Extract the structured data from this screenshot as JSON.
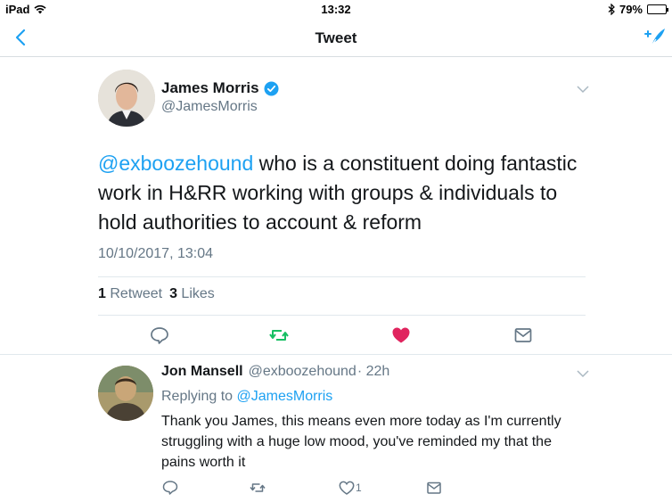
{
  "status_bar": {
    "device": "iPad",
    "time": "13:32",
    "battery": "79%",
    "battery_level": 0.79
  },
  "nav": {
    "title": "Tweet"
  },
  "tweet": {
    "author_name": "James Morris",
    "author_handle": "@JamesMorris",
    "mention": "@exboozehound",
    "text_line1": " who is a constituent doing fantastic",
    "text_rest": "work in H&RR working with groups & individuals to hold authorities to account & reform",
    "timestamp": "10/10/2017, 13:04",
    "retweet_count": "1",
    "retweet_label": "Retweet",
    "like_count": "3",
    "like_label": "Likes"
  },
  "reply": {
    "author_name": "Jon Mansell",
    "author_handle": "@exboozehound",
    "time_ago": "· 22h",
    "replying_prefix": "Replying to",
    "replying_to": "@JamesMorris",
    "text": "Thank you James, this means even more today as I'm currently struggling with a huge low mood, you've reminded my that the pains worth it",
    "like_count": "1"
  },
  "colors": {
    "accent": "#1da1f2",
    "retweet": "#17bf63",
    "like": "#e0245e",
    "secondary": "#657786"
  }
}
